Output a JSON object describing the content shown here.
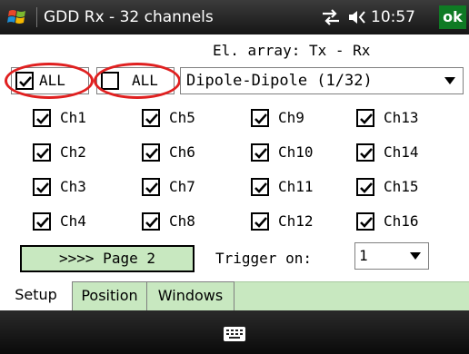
{
  "window": {
    "title": "GDD Rx - 32 channels",
    "time": "10:57",
    "ok_label": "ok"
  },
  "array": {
    "label": "El. array: Tx - Rx",
    "select_value": "Dipole-Dipole (1/32)"
  },
  "all_boxes": [
    {
      "label": "ALL",
      "checked": true
    },
    {
      "label": "ALL",
      "checked": false
    }
  ],
  "channels": [
    {
      "label": "Ch1",
      "checked": true
    },
    {
      "label": "Ch2",
      "checked": true
    },
    {
      "label": "Ch3",
      "checked": true
    },
    {
      "label": "Ch4",
      "checked": true
    },
    {
      "label": "Ch5",
      "checked": true
    },
    {
      "label": "Ch6",
      "checked": true
    },
    {
      "label": "Ch7",
      "checked": true
    },
    {
      "label": "Ch8",
      "checked": true
    },
    {
      "label": "Ch9",
      "checked": true
    },
    {
      "label": "Ch10",
      "checked": true
    },
    {
      "label": "Ch11",
      "checked": true
    },
    {
      "label": "Ch12",
      "checked": true
    },
    {
      "label": "Ch13",
      "checked": true
    },
    {
      "label": "Ch14",
      "checked": true
    },
    {
      "label": "Ch15",
      "checked": true
    },
    {
      "label": "Ch16",
      "checked": true
    }
  ],
  "page_button": ">>>> Page 2",
  "trigger": {
    "label": "Trigger on:",
    "value": "1"
  },
  "tabs": [
    {
      "label": "Setup",
      "active": true
    },
    {
      "label": "Position",
      "active": false
    },
    {
      "label": "Windows",
      "active": false
    }
  ],
  "colors": {
    "accent_green": "#c8e8c0",
    "highlight_ring": "#e02020",
    "ok_green": "#0f7a24"
  },
  "icons": [
    "windows-logo-icon",
    "connectivity-icon",
    "volume-icon",
    "keyboard-icon"
  ]
}
